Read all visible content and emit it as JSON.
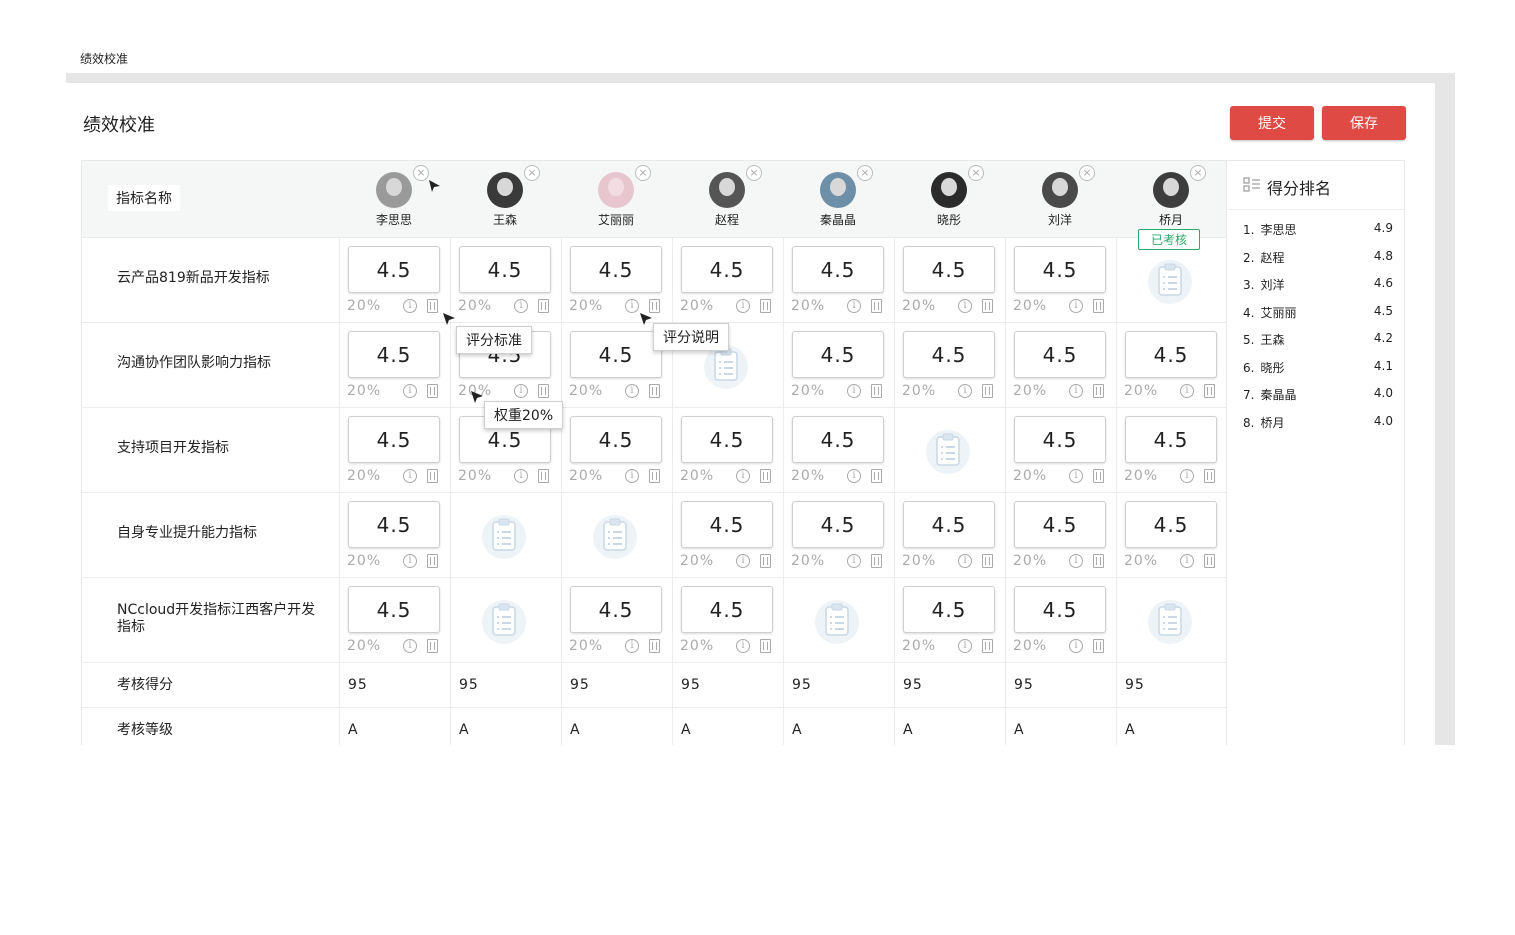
{
  "breadcrumb": "绩效校准",
  "page_title": "绩效校准",
  "buttons": {
    "submit": "提交",
    "save": "保存"
  },
  "table": {
    "name_col_header": "指标名称",
    "people": [
      {
        "name": "李思思"
      },
      {
        "name": "王森"
      },
      {
        "name": "艾丽丽"
      },
      {
        "name": "赵程"
      },
      {
        "name": "秦晶晶"
      },
      {
        "name": "晓彤"
      },
      {
        "name": "刘洋"
      },
      {
        "name": "桥月"
      }
    ],
    "remove_glyph": "×",
    "status_badge": "已考核",
    "indicators": [
      {
        "label": "云产品819新品开发指标",
        "cells": [
          "4.5",
          "4.5",
          "4.5",
          "4.5",
          "4.5",
          "4.5",
          "4.5",
          null
        ]
      },
      {
        "label": "沟通协作团队影响力指标",
        "cells": [
          "4.5",
          "4.5",
          "4.5",
          null,
          "4.5",
          "4.5",
          "4.5",
          "4.5"
        ]
      },
      {
        "label": "支持项目开发指标",
        "cells": [
          "4.5",
          "4.5",
          "4.5",
          "4.5",
          "4.5",
          null,
          "4.5",
          "4.5"
        ]
      },
      {
        "label": "自身专业提升能力指标",
        "cells": [
          "4.5",
          null,
          null,
          "4.5",
          "4.5",
          "4.5",
          "4.5",
          "4.5"
        ]
      },
      {
        "label": "NCcloud开发指标江西客户开发指标",
        "cells": [
          "4.5",
          null,
          "4.5",
          "4.5",
          null,
          "4.5",
          "4.5",
          null
        ]
      }
    ],
    "weight_text": "20%",
    "info_glyph": "i",
    "score_row": {
      "label": "考核得分",
      "values": [
        "95",
        "95",
        "95",
        "95",
        "95",
        "95",
        "95",
        "95"
      ]
    },
    "grade_row": {
      "label": "考核等级",
      "values": [
        "A",
        "A",
        "A",
        "A",
        "A",
        "A",
        "A",
        "A"
      ]
    }
  },
  "tooltips": {
    "scoring_standard": "评分标准",
    "scoring_note": "评分说明",
    "weight": "权重20%"
  },
  "ranking": {
    "title": "得分排名",
    "items": [
      {
        "rank": "1.",
        "name": "李思思",
        "score": "4.9"
      },
      {
        "rank": "2.",
        "name": "赵程",
        "score": "4.8"
      },
      {
        "rank": "3.",
        "name": "刘洋",
        "score": "4.6"
      },
      {
        "rank": "4.",
        "name": "艾丽丽",
        "score": "4.5"
      },
      {
        "rank": "5.",
        "name": "王森",
        "score": "4.2"
      },
      {
        "rank": "6.",
        "name": "晓彤",
        "score": "4.1"
      },
      {
        "rank": "7.",
        "name": "秦晶晶",
        "score": "4.0"
      },
      {
        "rank": "8.",
        "name": "桥月",
        "score": "4.0"
      }
    ]
  },
  "colors": {
    "primary_button": "#e04a44",
    "status_green": "#2fa76b"
  }
}
